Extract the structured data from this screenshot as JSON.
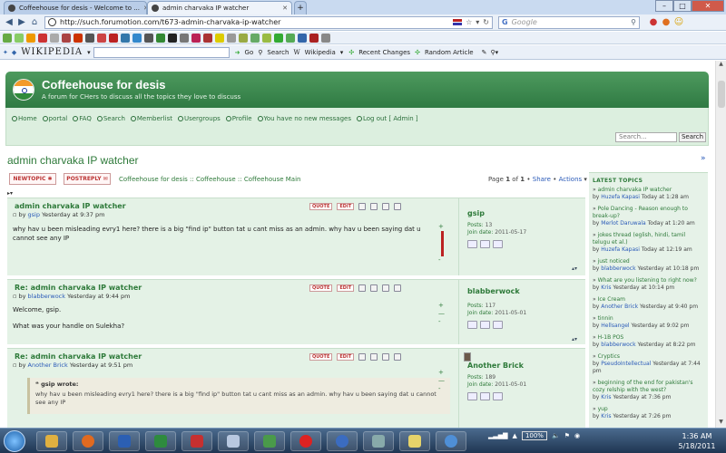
{
  "browser": {
    "tabs": [
      {
        "label": "Coffeehouse for desis - Welcome to ..."
      },
      {
        "label": "admin charvaka IP watcher"
      }
    ],
    "new_tab": "+",
    "url": "http://such.forumotion.com/t673-admin-charvaka-ip-watcher",
    "search_placeholder": "Google",
    "search_engine": "G",
    "window_buttons": {
      "minimize": "–",
      "maximize": "□",
      "close": "✕"
    }
  },
  "wiki_toolbar": {
    "logo": "WIKIPEDIA",
    "go": "Go",
    "search": "Search",
    "wikipedia": "Wikipedia",
    "recent_changes": "Recent Changes",
    "random_article": "Random Article"
  },
  "forum": {
    "title": "Coffeehouse for desis",
    "tagline": "A forum for CHers to discuss all the topics they love to discuss",
    "nav": [
      {
        "label": "Home"
      },
      {
        "label": "portal"
      },
      {
        "label": "FAQ"
      },
      {
        "label": "Search"
      },
      {
        "label": "Memberlist"
      },
      {
        "label": "Usergroups"
      },
      {
        "label": "Profile"
      },
      {
        "label": "You have no new messages"
      },
      {
        "label": "Log out [ Admin ]"
      }
    ],
    "search_placeholder": "Search...",
    "search_button": "Search"
  },
  "topic": {
    "title": "admin charvaka IP watcher",
    "newtopic": "NEWTOPIC",
    "postreply": "POSTREPLY",
    "breadcrumb": "Coffeehouse for desis :: Coffeehouse :: Coffeehouse Main",
    "page_prefix": "Page",
    "page_current": "1",
    "page_of": "of",
    "page_total": "1",
    "share": "Share",
    "actions": "Actions",
    "sep": "•"
  },
  "post_tools": {
    "quote": "QUOTE",
    "edit": "EDIT"
  },
  "posts": [
    {
      "title": "admin charvaka IP watcher",
      "by": "by",
      "author": "gsip",
      "time": "Yesterday at 9:37 pm",
      "body": "why hav u been misleading evry1 here? there is a big \"find ip\" button tat u cant miss as an admin. why hav u been saying dat u cannot see any IP",
      "username": "gsip",
      "posts_label": "Posts:",
      "posts": "13",
      "join_label": "Join date:",
      "join": "2011-05-17"
    },
    {
      "title": "Re: admin charvaka IP watcher",
      "by": "by",
      "author": "blabberwock",
      "time": "Yesterday at 9:44 pm",
      "body_lines": [
        "Welcome, gsip.",
        "What was your handle on Sulekha?"
      ],
      "username": "blabberwock",
      "posts_label": "Posts:",
      "posts": "117",
      "join_label": "Join date:",
      "join": "2011-05-01"
    },
    {
      "title": "Re: admin charvaka IP watcher",
      "by": "by",
      "author": "Another Brick",
      "time": "Yesterday at 9:51 pm",
      "quote_header": "gsip wrote:",
      "quote_body": "why hav u been misleading evry1 here? there is a big \"find ip\" button tat u cant miss as an admin. why hav u been saying dat u cannot see any IP",
      "username": "Another Brick",
      "posts_label": "Posts:",
      "posts": "189",
      "join_label": "Join date:",
      "join": "2011-05-01"
    }
  ],
  "sidebar": {
    "heading": "LATEST TOPICS",
    "by": "by",
    "items": [
      {
        "title": "admin charvaka IP watcher",
        "who": "Huzefa Kapasi",
        "time": "Today at 1:28 am"
      },
      {
        "title": "Pole Dancing - Reason enough to break-up?",
        "who": "Merlot Daruwala",
        "time": "Today at 1:20 am"
      },
      {
        "title": "jokes thread (eglish, hindi, tamil telugu et al.)",
        "who": "Huzefa Kapasi",
        "time": "Today at 12:19 am"
      },
      {
        "title": "just noticed",
        "who": "blabberwock",
        "time": "Yesterday at 10:18 pm"
      },
      {
        "title": "What are you listening to right now?",
        "who": "Kris",
        "time": "Yesterday at 10:14 pm"
      },
      {
        "title": "Ice Cream",
        "who": "Another Brick",
        "time": "Yesterday at 9:40 pm"
      },
      {
        "title": "tinnin",
        "who": "Hellsangel",
        "time": "Yesterday at 9:02 pm"
      },
      {
        "title": "H-1B POS",
        "who": "blabberwock",
        "time": "Yesterday at 8:22 pm"
      },
      {
        "title": "Cryptics",
        "who": "PseudoIntellectual",
        "time": "Yesterday at 7:44 pm"
      },
      {
        "title": "beginning of the end for pakistan's cozy relship with the west?",
        "who": "Kris",
        "time": "Yesterday at 7:36 pm"
      },
      {
        "title": "yup",
        "who": "Kris",
        "time": "Yesterday at 7:26 pm"
      }
    ]
  },
  "taskbar": {
    "battery": "100%",
    "time": "1:36 AM",
    "date": "5/18/2011"
  },
  "colors": {
    "accent": "#2e7a3a",
    "header": "#3f8b50",
    "post_bg": "#e4f2e6"
  }
}
